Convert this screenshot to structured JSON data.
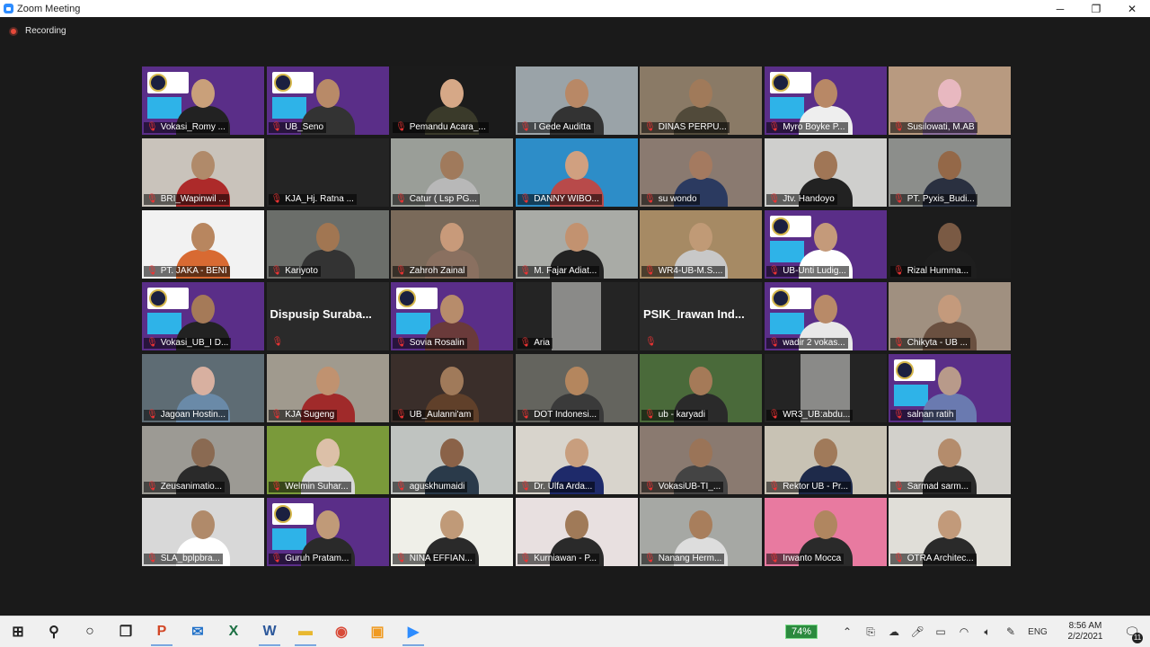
{
  "window": {
    "title": "Zoom Meeting",
    "minimize": "─",
    "maximize": "❐",
    "close": "✕"
  },
  "recording": {
    "label": "Recording"
  },
  "colors": {
    "active_border": "#e9f26a",
    "muted_mic": "#e33333",
    "recording_dot": "#e5493a"
  },
  "participants": [
    {
      "name": "Vokasi_Romy ...",
      "bg": "logo",
      "skin": "#c9a07a",
      "shirt": "#222"
    },
    {
      "name": "UB_Seno",
      "bg": "logo",
      "skin": "#b88a68",
      "shirt": "#333"
    },
    {
      "name": "Pemandu Acara_...",
      "bg": "#1b1b1b",
      "skin": "#d6a887",
      "shirt": "#3a3a2a",
      "active": true
    },
    {
      "name": "I Gede Auditta",
      "bg": "#9aa3a8",
      "skin": "#b88866",
      "shirt": "#333"
    },
    {
      "name": "DINAS PERPU...",
      "bg": "#8a7a66",
      "skin": "#a07a5a",
      "shirt": "#514a3a"
    },
    {
      "name": "Myro Boyke P...",
      "bg": "logo",
      "skin": "#b88866",
      "shirt": "#eee"
    },
    {
      "name": "Susilowati, M.AB",
      "bg": "#b89a80",
      "skin": "#e8b8c0",
      "shirt": "#8a6e9a"
    },
    {
      "name": "BRI_Wapinwil ...",
      "bg": "#c9c3bb",
      "skin": "#b08a6a",
      "shirt": "#ad2a2a"
    },
    {
      "name": "KJA_Hj. Ratna ...",
      "bg": "#242424",
      "empty": true
    },
    {
      "name": "Catur ( Lsp PG...",
      "bg": "#9a9e98",
      "skin": "#a07a5c",
      "shirt": "#b8b8b8"
    },
    {
      "name": "DANNY WIBO...",
      "bg": "#2d8dc8",
      "skin": "#d0a080",
      "shirt": "#b84a4a"
    },
    {
      "name": "su wondo",
      "bg": "#8a7a70",
      "skin": "#a47a60",
      "shirt": "#2b3a60"
    },
    {
      "name": "Jtv. Handoyo",
      "bg": "#cfcfcd",
      "skin": "#a07656",
      "shirt": "#222"
    },
    {
      "name": "PT. Pyxis_Budi...",
      "bg": "#8c8e8b",
      "skin": "#946848",
      "shirt": "#2a3040"
    },
    {
      "name": "PT. JAKA - BENI",
      "bg": "#f2f2f2",
      "skin": "#b8865f",
      "shirt": "#d86a32"
    },
    {
      "name": "Kariyoto",
      "bg": "#6b6e6a",
      "skin": "#a17652",
      "shirt": "#333"
    },
    {
      "name": "Zahroh Zainal",
      "bg": "#7a6a5a",
      "skin": "#c89a7a",
      "shirt": "#8a7060"
    },
    {
      "name": "M. Fajar Adiat...",
      "bg": "#a9aba6",
      "skin": "#c29270",
      "shirt": "#222"
    },
    {
      "name": "WR4-UB-M.S....",
      "bg": "#a68a64",
      "skin": "#c09a76",
      "shirt": "#c8c8c8"
    },
    {
      "name": "UB-Unti Ludig...",
      "bg": "logo",
      "skin": "#c49a7a",
      "shirt": "#fff"
    },
    {
      "name": "Rizal Humma...",
      "bg": "#1c1c1c",
      "skin": "#7a5a44",
      "shirt": "#1e1e1e"
    },
    {
      "name": "Vokasi_UB_I D...",
      "bg": "logo",
      "skin": "#a57a58",
      "shirt": "#222"
    },
    {
      "name": "Dispusip Suraba...",
      "bg": "#242424",
      "bigname": true
    },
    {
      "name": "Sovia Rosalin",
      "bg": "logo",
      "skin": "#b78c6b",
      "shirt": "#6a3a3a"
    },
    {
      "name": "Aria",
      "bg": "#242424",
      "small": true
    },
    {
      "name": "PSIK_Irawan Ind...",
      "bg": "#242424",
      "bigname": true
    },
    {
      "name": "wadir 2 vokas...",
      "bg": "logo",
      "skin": "#b88a68",
      "shirt": "#e8e8e8"
    },
    {
      "name": "Chikyta - UB ...",
      "bg": "#a09080",
      "skin": "#c49a7c",
      "shirt": "#6a5040"
    },
    {
      "name": "Jagoan Hostin...",
      "bg": "#5e6c74",
      "skin": "#d8b0a0",
      "shirt": "#6a8aa8"
    },
    {
      "name": "KJA Sugeng",
      "bg": "#a09a8e",
      "skin": "#c09270",
      "shirt": "#a02a2a"
    },
    {
      "name": "UB_Aulanni'am",
      "bg": "#3a2e2a",
      "skin": "#a07a5a",
      "shirt": "#60402a"
    },
    {
      "name": "DOT Indonesi...",
      "bg": "#64645e",
      "skin": "#b4865e",
      "shirt": "#3a3a3a"
    },
    {
      "name": "ub - karyadi",
      "bg": "#4a6a3a",
      "skin": "#a57a58",
      "shirt": "#2a2a2a"
    },
    {
      "name": "WR3_UB:abdu...",
      "bg": "#242424",
      "small": true
    },
    {
      "name": "salnan ratih",
      "bg": "logo",
      "skin": "#b89a8a",
      "shirt": "#6a7ab0"
    },
    {
      "name": "Zeusanimatio...",
      "bg": "#9c9a94",
      "skin": "#8a6a52",
      "shirt": "#2a2a2a"
    },
    {
      "name": "Welmin Suhar...",
      "bg": "#7a9a3a",
      "skin": "#dcc0a8",
      "shirt": "#d8d8d8"
    },
    {
      "name": "aguskhumaidi",
      "bg": "#bfc3c0",
      "skin": "#8a6248",
      "shirt": "#2a3a4a"
    },
    {
      "name": "Dr. Ulfa Arda...",
      "bg": "#d8d4cc",
      "skin": "#c89e7e",
      "shirt": "#1e2a6a"
    },
    {
      "name": "VokasiUB-TI_...",
      "bg": "#8a7a70",
      "skin": "#9a7458",
      "shirt": "#444"
    },
    {
      "name": "Rektor UB - Pr...",
      "bg": "#c8c2b4",
      "skin": "#a07a5a",
      "shirt": "#1e2a4a"
    },
    {
      "name": "Sarmad sarm...",
      "bg": "#d2d0cb",
      "skin": "#b48c6c",
      "shirt": "#2a2a2a"
    },
    {
      "name": "SLA_bplpbra...",
      "bg": "#d8d8d8",
      "skin": "#b08a6a",
      "shirt": "#fff"
    },
    {
      "name": "Guruh Pratam...",
      "bg": "logo",
      "skin": "#c09a78",
      "shirt": "#2a2a2a"
    },
    {
      "name": "NINA EFFIAN...",
      "bg": "#efefe8",
      "skin": "#c09a78",
      "shirt": "#2a2a2a"
    },
    {
      "name": "Kurniawan - P...",
      "bg": "#e8e0e0",
      "skin": "#a07a58",
      "shirt": "#2a2a2a"
    },
    {
      "name": "Nanang Herm...",
      "bg": "#a6a8a4",
      "skin": "#a87e5c",
      "shirt": "#ddd"
    },
    {
      "name": "Irwanto Mocca",
      "bg": "#e87aa0",
      "skin": "#b08660",
      "shirt": "#2a2a2a"
    },
    {
      "name": "OTRA Architec...",
      "bg": "#e0ded8",
      "skin": "#c29a7a",
      "shirt": "#2a2a2a"
    }
  ],
  "taskbar": {
    "apps": [
      {
        "icon": "windows-start-icon",
        "glyph": "⊞",
        "color": "#222"
      },
      {
        "icon": "search-icon",
        "glyph": "⚲",
        "color": "#222"
      },
      {
        "icon": "cortana-icon",
        "glyph": "○",
        "color": "#222"
      },
      {
        "icon": "task-view-icon",
        "glyph": "❐",
        "color": "#222"
      },
      {
        "icon": "powerpoint-icon",
        "glyph": "P",
        "color": "#d24726",
        "running": true
      },
      {
        "icon": "mail-icon",
        "glyph": "✉",
        "color": "#1e6fc8"
      },
      {
        "icon": "excel-icon",
        "glyph": "X",
        "color": "#1d7044"
      },
      {
        "icon": "word-icon",
        "glyph": "W",
        "color": "#2b579a",
        "running": true
      },
      {
        "icon": "file-explorer-icon",
        "glyph": "▬",
        "color": "#e8b830",
        "running": true
      },
      {
        "icon": "chrome-icon",
        "glyph": "◉",
        "color": "#d84a38"
      },
      {
        "icon": "app-orange-icon",
        "glyph": "▣",
        "color": "#f09a20"
      },
      {
        "icon": "zoom-icon",
        "glyph": "▶",
        "color": "#2d8cff",
        "running": true
      }
    ],
    "battery": "74%",
    "language": "ENG",
    "time": "8:56 AM",
    "date": "2/2/2021",
    "notifications": "11"
  }
}
